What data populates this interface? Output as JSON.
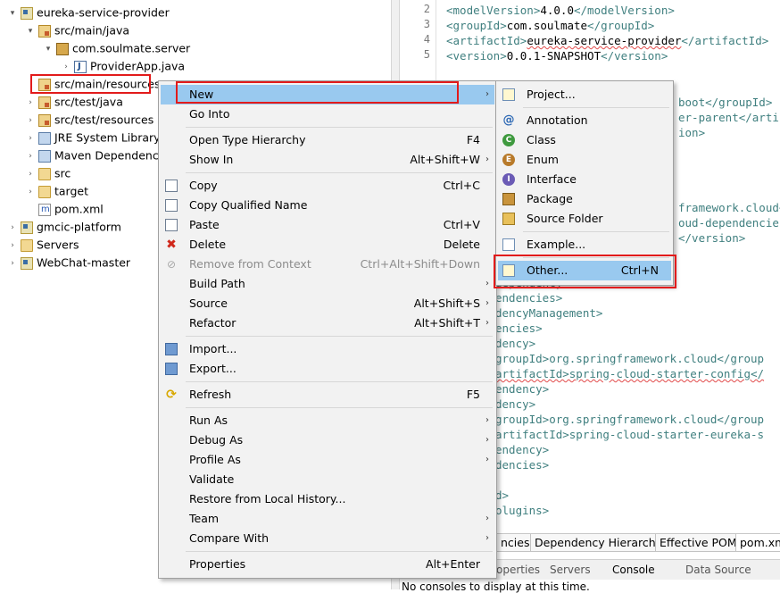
{
  "tree": {
    "items": [
      {
        "label": "eureka-service-provider",
        "twisty": "▾",
        "icon": "project-icon"
      },
      {
        "label": "src/main/java",
        "twisty": "▾",
        "icon": "source-folder-icon"
      },
      {
        "label": "com.soulmate.server",
        "twisty": "▾",
        "icon": "package-icon"
      },
      {
        "label": "ProviderApp.java",
        "twisty": "›",
        "icon": "java-file-icon"
      },
      {
        "label": "src/main/resources",
        "twisty": "",
        "icon": "source-folder-icon"
      },
      {
        "label": "src/test/java",
        "twisty": "›",
        "icon": "source-folder-icon"
      },
      {
        "label": "src/test/resources",
        "twisty": "›",
        "icon": "source-folder-icon"
      },
      {
        "label": "JRE System Library",
        "twisty": "›",
        "icon": "library-icon"
      },
      {
        "label": "Maven Dependencies",
        "twisty": "›",
        "icon": "library-icon"
      },
      {
        "label": "src",
        "twisty": "›",
        "icon": "folder-icon"
      },
      {
        "label": "target",
        "twisty": "›",
        "icon": "folder-icon"
      },
      {
        "label": "pom.xml",
        "twisty": "",
        "icon": "xml-file-icon"
      },
      {
        "label": "gmcic-platform",
        "twisty": "›",
        "icon": "project-icon"
      },
      {
        "label": "Servers",
        "twisty": "›",
        "icon": "folder-icon"
      },
      {
        "label": "WebChat-master",
        "twisty": "›",
        "icon": "project-icon"
      }
    ]
  },
  "editor": {
    "line_numbers": [
      "2",
      "3",
      "4",
      "5"
    ],
    "lines": [
      {
        "open": "<modelVersion>",
        "text": "4.0.0",
        "close": "</modelVersion>"
      },
      {
        "open": "<groupId>",
        "text": "com.soulmate",
        "close": "</groupId>"
      },
      {
        "open": "<artifactId>",
        "text": "eureka-service-provider",
        "close": "</artifactId>"
      },
      {
        "open": "<version>",
        "text": "0.0.1-SNAPSHOT",
        "close": "</version>"
      }
    ],
    "visible_fragments": [
      "boot</groupId>",
      "er-parent</artif",
      "ion>",
      "framework.cloud</g",
      "oud-dependencies",
      "</version>",
      "dependency>",
      "endencies>",
      "dencyManagement>",
      "encies>",
      "dency>",
      "groupId>org.springframework.cloud</group",
      "artifactId>spring-cloud-starter-config</",
      "endency>",
      "dency>",
      "groupId>org.springframework.cloud</group",
      "artifactId>spring-cloud-starter-eureka-s",
      "endency>",
      "dencies>",
      "d>",
      "olugins>"
    ]
  },
  "pom_tabs": [
    "ncies",
    "Dependency Hierarchy",
    "Effective POM",
    "pom.xm"
  ],
  "view_tabs": [
    "operties",
    "Servers",
    "Console",
    "Data Source"
  ],
  "console_message": "No consoles to display at this time.",
  "context_menu": {
    "items": [
      {
        "label": "New",
        "shortcut": "",
        "arrow": "›",
        "icon": "",
        "highlight": true
      },
      {
        "label": "Go Into",
        "shortcut": "",
        "arrow": "",
        "icon": ""
      },
      {
        "sep": true
      },
      {
        "label": "Open Type Hierarchy",
        "shortcut": "F4",
        "arrow": "",
        "icon": ""
      },
      {
        "label": "Show In",
        "shortcut": "Alt+Shift+W",
        "arrow": "›",
        "icon": ""
      },
      {
        "sep": true
      },
      {
        "label": "Copy",
        "shortcut": "Ctrl+C",
        "arrow": "",
        "icon": "copy-icon"
      },
      {
        "label": "Copy Qualified Name",
        "shortcut": "",
        "arrow": "",
        "icon": "copy-icon"
      },
      {
        "label": "Paste",
        "shortcut": "Ctrl+V",
        "arrow": "",
        "icon": "paste-icon"
      },
      {
        "label": "Delete",
        "shortcut": "Delete",
        "arrow": "",
        "icon": "delete-icon"
      },
      {
        "label": "Remove from Context",
        "shortcut": "Ctrl+Alt+Shift+Down",
        "arrow": "",
        "icon": "remove-icon",
        "disabled": true
      },
      {
        "label": "Build Path",
        "shortcut": "",
        "arrow": "›",
        "icon": ""
      },
      {
        "label": "Source",
        "shortcut": "Alt+Shift+S",
        "arrow": "›",
        "icon": ""
      },
      {
        "label": "Refactor",
        "shortcut": "Alt+Shift+T",
        "arrow": "›",
        "icon": ""
      },
      {
        "sep": true
      },
      {
        "label": "Import...",
        "shortcut": "",
        "arrow": "",
        "icon": "import-icon"
      },
      {
        "label": "Export...",
        "shortcut": "",
        "arrow": "",
        "icon": "export-icon"
      },
      {
        "sep": true
      },
      {
        "label": "Refresh",
        "shortcut": "F5",
        "arrow": "",
        "icon": "refresh-icon"
      },
      {
        "sep": true
      },
      {
        "label": "Run As",
        "shortcut": "",
        "arrow": "›",
        "icon": ""
      },
      {
        "label": "Debug As",
        "shortcut": "",
        "arrow": "›",
        "icon": ""
      },
      {
        "label": "Profile As",
        "shortcut": "",
        "arrow": "›",
        "icon": ""
      },
      {
        "label": "Validate",
        "shortcut": "",
        "arrow": "",
        "icon": ""
      },
      {
        "label": "Restore from Local History...",
        "shortcut": "",
        "arrow": "",
        "icon": ""
      },
      {
        "label": "Team",
        "shortcut": "",
        "arrow": "›",
        "icon": ""
      },
      {
        "label": "Compare With",
        "shortcut": "",
        "arrow": "›",
        "icon": ""
      },
      {
        "sep": true
      },
      {
        "label": "Properties",
        "shortcut": "Alt+Enter",
        "arrow": "",
        "icon": ""
      }
    ]
  },
  "submenu": {
    "items": [
      {
        "label": "Project...",
        "shortcut": "",
        "icon": "project-wizard-icon"
      },
      {
        "sep": true
      },
      {
        "label": "Annotation",
        "shortcut": "",
        "icon": "annotation-icon"
      },
      {
        "label": "Class",
        "shortcut": "",
        "icon": "class-icon"
      },
      {
        "label": "Enum",
        "shortcut": "",
        "icon": "enum-icon"
      },
      {
        "label": "Interface",
        "shortcut": "",
        "icon": "interface-icon"
      },
      {
        "label": "Package",
        "shortcut": "",
        "icon": "package-icon"
      },
      {
        "label": "Source Folder",
        "shortcut": "",
        "icon": "source-folder-icon"
      },
      {
        "sep": true
      },
      {
        "label": "Example...",
        "shortcut": "",
        "icon": "example-icon"
      },
      {
        "sep": true
      },
      {
        "label": "Other...",
        "shortcut": "Ctrl+N",
        "icon": "other-wizard-icon",
        "highlight": true
      }
    ]
  },
  "colors": {
    "highlight": "#99c9ef",
    "annotation_box": "#e21b1b",
    "xml_tag": "#3f7f7f"
  }
}
